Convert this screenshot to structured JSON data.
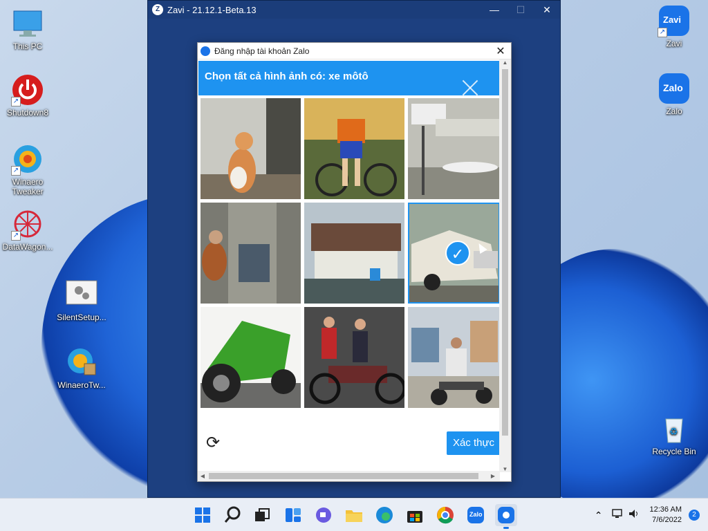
{
  "desktop": {
    "icons_left": [
      {
        "label": "This PC",
        "icon": "monitor-icon"
      },
      {
        "label": "Shutdown8",
        "icon": "power-icon"
      },
      {
        "label": "Winaero Tweaker",
        "icon": "winaero-icon"
      },
      {
        "label": "DataWagon...",
        "icon": "datawagon-icon"
      },
      {
        "label": "SilentSetup...",
        "icon": "setup-gear-icon"
      },
      {
        "label": "WinaeroTw...",
        "icon": "winaero-package-icon"
      }
    ],
    "icons_right": [
      {
        "label": "Zavi",
        "icon": "zavi-icon",
        "logo_text": "Zavi"
      },
      {
        "label": "Zalo",
        "icon": "zalo-icon",
        "logo_text": "Zalo"
      },
      {
        "label": "Recycle Bin",
        "icon": "recycle-bin-icon"
      }
    ]
  },
  "zavi_window": {
    "title": "Zavi - 21.12.1-Beta.13",
    "controls": {
      "minimize": "—",
      "maximize": "☐",
      "close": "✕"
    }
  },
  "login_dialog": {
    "title": "Đăng nhập tài khoản Zalo",
    "close": "✕",
    "captcha": {
      "prompt": "Chọn tất cả hình ảnh có: xe môtô",
      "tiles": [
        {
          "subject": "kitten",
          "selected": false
        },
        {
          "subject": "cyclist",
          "selected": false
        },
        {
          "subject": "airport",
          "selected": false
        },
        {
          "subject": "subway-passenger",
          "selected": false
        },
        {
          "subject": "houseboat",
          "selected": false
        },
        {
          "subject": "vintage-car",
          "selected": true
        },
        {
          "subject": "green-motorcycle",
          "selected": false
        },
        {
          "subject": "classic-motorcycle",
          "selected": false
        },
        {
          "subject": "street-motorcycle",
          "selected": false
        }
      ],
      "refresh_glyph": "⟳",
      "verify_label": "Xác thực"
    }
  },
  "taskbar": {
    "apps": [
      "start",
      "search",
      "task-view",
      "widgets",
      "chat",
      "file-explorer",
      "edge",
      "store",
      "chrome",
      "zalo",
      "zavi"
    ],
    "active_app": "zavi",
    "zalo_badge": "Zalo",
    "clock_time": "12:36 AM",
    "clock_date": "7/6/2022",
    "notification_count": "2"
  },
  "colors": {
    "accent": "#1e93f0",
    "zavi_bg": "#1d4080",
    "taskbar": "#e9eef6"
  }
}
